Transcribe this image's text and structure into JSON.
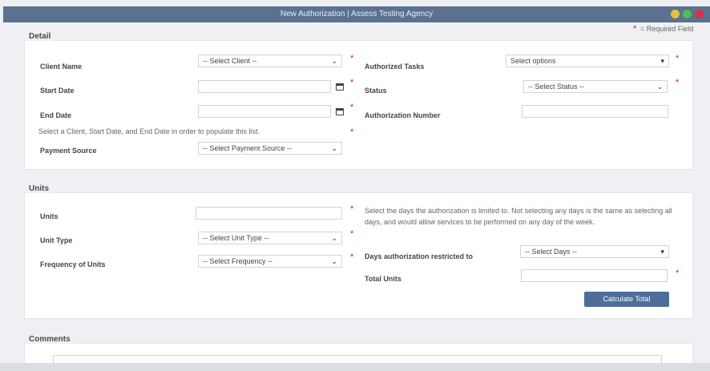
{
  "window": {
    "title": "New Authorization | Assess Testing Agency"
  },
  "required_note": "= Required Field",
  "detail": {
    "legend": "Detail",
    "client_name": {
      "label": "Client Name",
      "value": "-- Select Client --"
    },
    "start_date": {
      "label": "Start Date",
      "value": ""
    },
    "end_date": {
      "label": "End Date",
      "value": ""
    },
    "hint": "Select a Client, Start Date, and End Date in order to populate this list.",
    "payment_source": {
      "label": "Payment Source",
      "value": "-- Select Payment Source --"
    },
    "authorized_tasks": {
      "label": "Authorized Tasks",
      "value": "Select options"
    },
    "status": {
      "label": "Status",
      "value": "-- Select Status --"
    },
    "authorization_number": {
      "label": "Authorization Number",
      "value": ""
    }
  },
  "units": {
    "legend": "Units",
    "units": {
      "label": "Units",
      "value": ""
    },
    "unit_type": {
      "label": "Unit Type",
      "value": "-- Select Unit Type --"
    },
    "frequency": {
      "label": "Frequency of Units",
      "value": "-- Select Frequency --"
    },
    "days_note": "Select the days the authorization is limited to. Not selecting any days is the same as selecting all days, and would allow services to be performed on any day of the week.",
    "days_restricted": {
      "label": "Days authorization restricted to",
      "value": "-- Select Days --"
    },
    "total_units": {
      "label": "Total Units",
      "value": ""
    },
    "calculate_button": "Calculate Total"
  },
  "comments": {
    "legend": "Comments"
  },
  "icons": {
    "calendar": "calendar-icon",
    "chevron": "chevron-down-icon",
    "required": "required-star-icon"
  },
  "colors": {
    "titlebar": "#5a7191",
    "required": "#d8193a",
    "button": "#4d6e98"
  }
}
